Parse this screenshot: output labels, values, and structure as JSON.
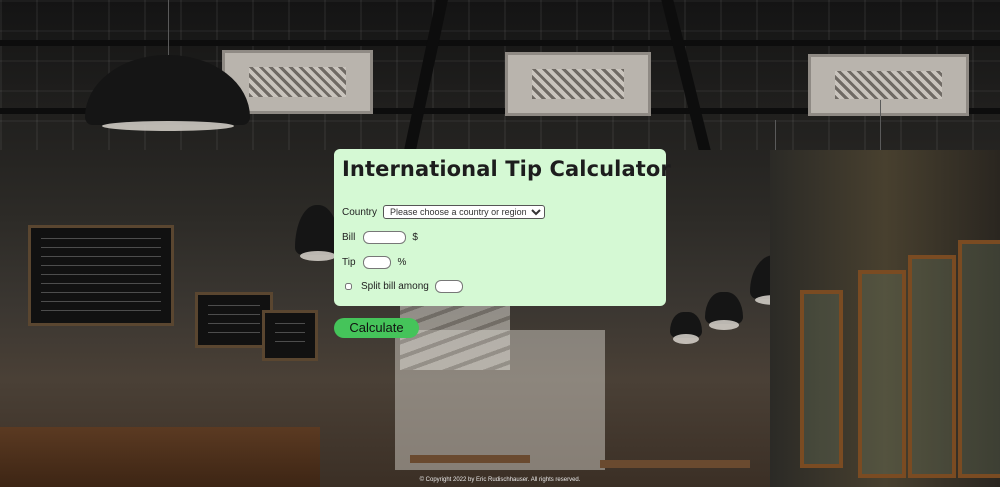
{
  "app": {
    "title": "International Tip Calculator"
  },
  "form": {
    "country_label": "Country",
    "country_selected": "Please choose a country or region:",
    "bill_label": "Bill",
    "bill_value": "",
    "bill_unit": "$",
    "tip_label": "Tip",
    "tip_value": "",
    "tip_unit": "%",
    "split_label": "Split bill among",
    "split_checked": false,
    "split_value": ""
  },
  "actions": {
    "calculate_label": "Calculate"
  },
  "footer": {
    "copyright": "© Copyright 2022 by Eric Rudischhauser. All rights reserved."
  },
  "colors": {
    "card_background": "#d5f9d4",
    "button_background": "#45c45a",
    "title_text": "#1d1d1d"
  }
}
